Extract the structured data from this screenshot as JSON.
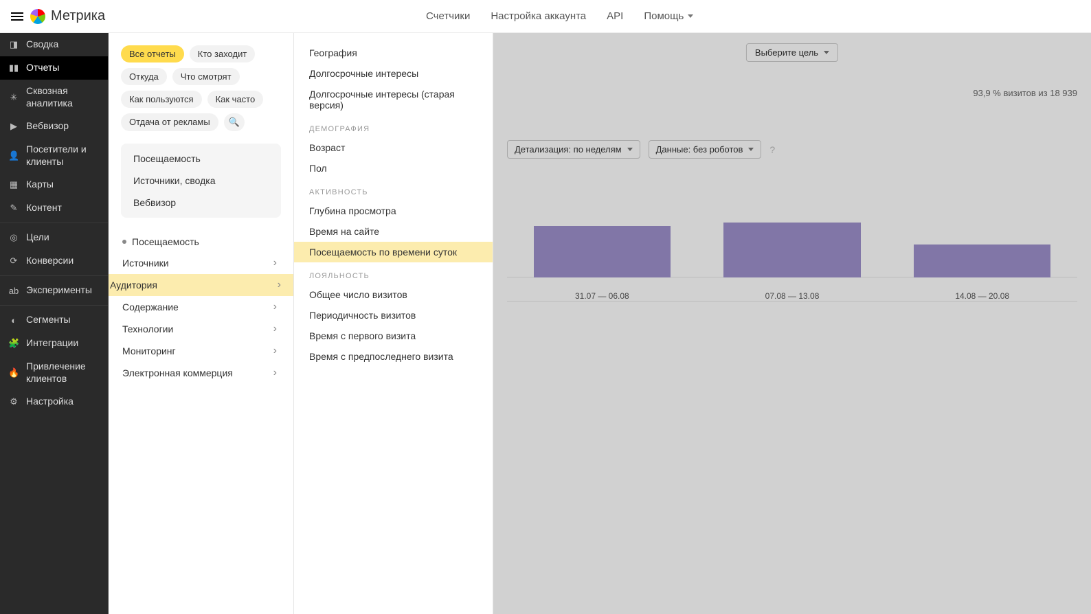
{
  "header": {
    "brand": "Метрика",
    "nav": [
      "Счетчики",
      "Настройка аккаунта",
      "API",
      "Помощь"
    ]
  },
  "sidebar": {
    "items": [
      {
        "icon": "◨",
        "label": "Сводка"
      },
      {
        "icon": "▮▮",
        "label": "Отчеты",
        "active": true
      },
      {
        "icon": "✳",
        "label": "Сквозная аналитика"
      },
      {
        "icon": "▶",
        "label": "Вебвизор"
      },
      {
        "icon": "👤",
        "label": "Посетители и клиенты"
      },
      {
        "icon": "▦",
        "label": "Карты"
      },
      {
        "icon": "✎",
        "label": "Контент"
      },
      {
        "sep": true
      },
      {
        "icon": "◎",
        "label": "Цели"
      },
      {
        "icon": "⟳",
        "label": "Конверсии"
      },
      {
        "sep": true
      },
      {
        "icon": "ab",
        "label": "Эксперименты"
      },
      {
        "sep": true
      },
      {
        "icon": "◐",
        "label": "Сегменты"
      },
      {
        "icon": "🧩",
        "label": "Интеграции"
      },
      {
        "icon": "🔥",
        "label": "Привлечение клиентов"
      },
      {
        "icon": "⚙",
        "label": "Настройка"
      }
    ]
  },
  "panel1": {
    "chips": [
      "Все отчеты",
      "Кто заходит",
      "Откуда",
      "Что смотрят",
      "Как пользуются",
      "Как часто",
      "Отдача от рекламы"
    ],
    "quick": [
      "Посещаемость",
      "Источники, сводка",
      "Вебвизор"
    ],
    "tree": [
      {
        "label": "Посещаемость",
        "bullet": true
      },
      {
        "label": "Источники",
        "arrow": true
      },
      {
        "label": "Аудитория",
        "arrow": true,
        "highlight": true
      },
      {
        "label": "Содержание",
        "arrow": true
      },
      {
        "label": "Технологии",
        "arrow": true
      },
      {
        "label": "Мониторинг",
        "arrow": true
      },
      {
        "label": "Электронная коммерция",
        "arrow": true
      }
    ]
  },
  "panel2": {
    "pre": [
      "География",
      "Долгосрочные интересы",
      "Долгосрочные интересы (старая версия)"
    ],
    "groups": [
      {
        "title": "ДЕМОГРАФИЯ",
        "items": [
          "Возраст",
          "Пол"
        ]
      },
      {
        "title": "АКТИВНОСТЬ",
        "items": [
          "Глубина просмотра",
          "Время на сайте",
          "Посещаемость по времени суток"
        ]
      },
      {
        "title": "ЛОЯЛЬНОСТЬ",
        "items": [
          "Общее число визитов",
          "Периодичность визитов",
          "Время с первого визита",
          "Время с предпоследнего визита"
        ]
      }
    ],
    "highlighted": "Посещаемость по времени суток"
  },
  "content": {
    "stats_text": "93,9 % визитов из 18 939",
    "detail_label": "Детализация: по неделям",
    "data_label": "Данные: без роботов",
    "goal_label": "Выберите цель"
  },
  "chart_data": {
    "type": "bar",
    "categories": [
      "31.07 — 06.08",
      "07.08 — 13.08",
      "14.08 — 20.08"
    ],
    "values": [
      270,
      290,
      175
    ],
    "title": "",
    "xlabel": "",
    "ylabel": "",
    "ylim": [
      0,
      420
    ]
  }
}
